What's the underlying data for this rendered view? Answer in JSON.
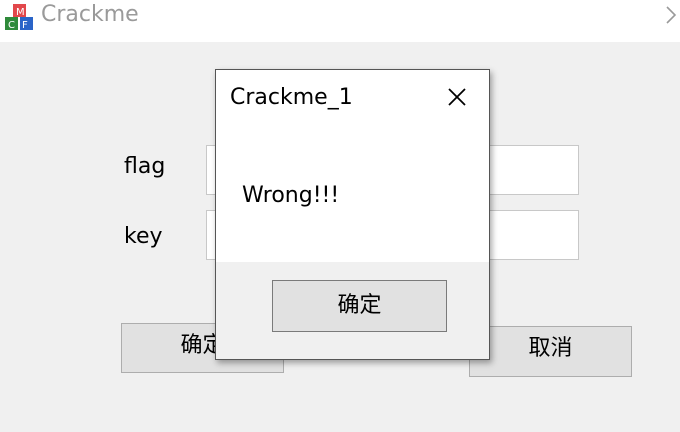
{
  "window": {
    "title": "Crackme",
    "icon": "msvc-app-icon"
  },
  "form": {
    "flag_label": "flag",
    "key_label": "key",
    "flag_value": "",
    "key_value": "",
    "ok_label": "确定",
    "cancel_label": "取消"
  },
  "dialog": {
    "title": "Crackme_1",
    "message": "Wrong!!!",
    "ok_label": "确定"
  },
  "colors": {
    "window_bg": "#f0f0f0",
    "title_text": "#9a9a9a",
    "button_bg": "#e1e1e1"
  }
}
